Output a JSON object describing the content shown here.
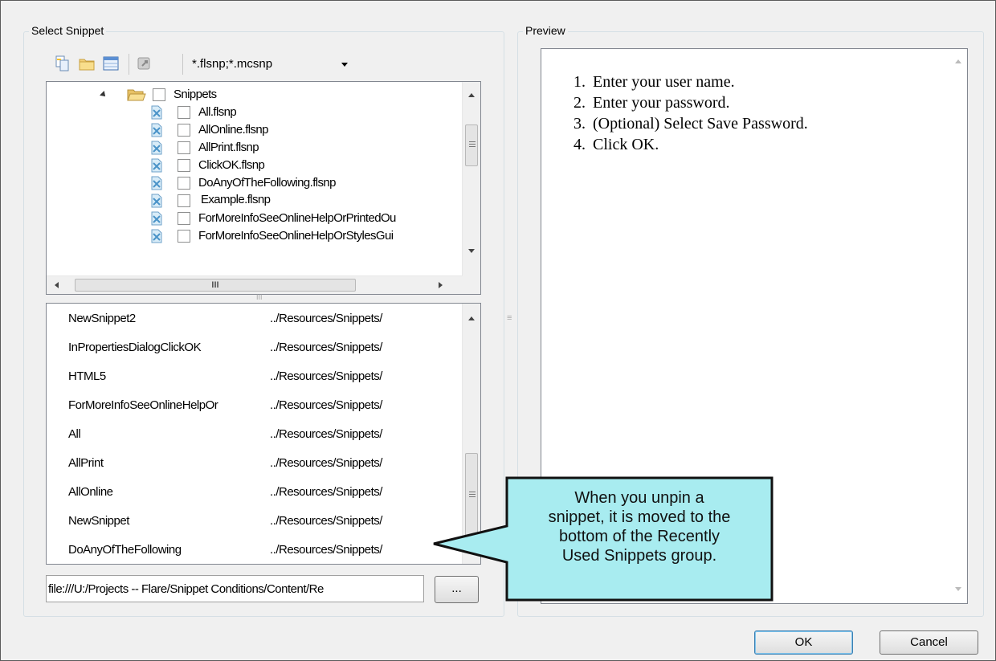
{
  "select_snippet": {
    "title": "Select Snippet",
    "toolbar": {
      "icons": [
        "copy-icon",
        "folder-icon",
        "table-icon",
        "pin-icon"
      ],
      "filter_value": "*.flsnp;*.mcsnp"
    },
    "tree": {
      "folder": "Snippets",
      "items": [
        "All.flsnp",
        "AllOnline.flsnp",
        "AllPrint.flsnp",
        "ClickOK.flsnp",
        "DoAnyOfTheFollowing.flsnp",
        "Example.flsnp",
        "ForMoreInfoSeeOnlineHelpOrPrintedOu",
        "ForMoreInfoSeeOnlineHelpOrStylesGui"
      ],
      "selected": "Example.flsnp"
    },
    "recent": [
      {
        "name": "NewSnippet2",
        "path": "../Resources/Snippets/"
      },
      {
        "name": "InPropertiesDialogClickOK",
        "path": "../Resources/Snippets/"
      },
      {
        "name": "HTML5",
        "path": "../Resources/Snippets/"
      },
      {
        "name": "ForMoreInfoSeeOnlineHelpOr",
        "path": "../Resources/Snippets/"
      },
      {
        "name": "All",
        "path": "../Resources/Snippets/"
      },
      {
        "name": "AllPrint",
        "path": "../Resources/Snippets/"
      },
      {
        "name": "AllOnline",
        "path": "../Resources/Snippets/"
      },
      {
        "name": "NewSnippet",
        "path": "../Resources/Snippets/"
      },
      {
        "name": "DoAnyOfTheFollowing",
        "path": "../Resources/Snippets/"
      }
    ],
    "path_value": "file:///U:/Projects -- Flare/Snippet Conditions/Content/Re",
    "browse_label": "..."
  },
  "preview": {
    "title": "Preview",
    "steps": [
      {
        "num": "1.",
        "text": "Enter your user name."
      },
      {
        "num": "2.",
        "text": "Enter your password."
      },
      {
        "num": "3.",
        "text": "(Optional) Select Save Password."
      },
      {
        "num": "4.",
        "text": "Click OK."
      }
    ]
  },
  "callout": {
    "lines": [
      "When you unpin a",
      "snippet, it is moved to the",
      "bottom of the Recently",
      "Used Snippets group."
    ],
    "fill": "#a8ecf0"
  },
  "buttons": {
    "ok": "OK",
    "cancel": "Cancel"
  },
  "scrollbar_labels": {
    "h_grip": "III",
    "v_grip": "≡",
    "splitter": "III"
  }
}
